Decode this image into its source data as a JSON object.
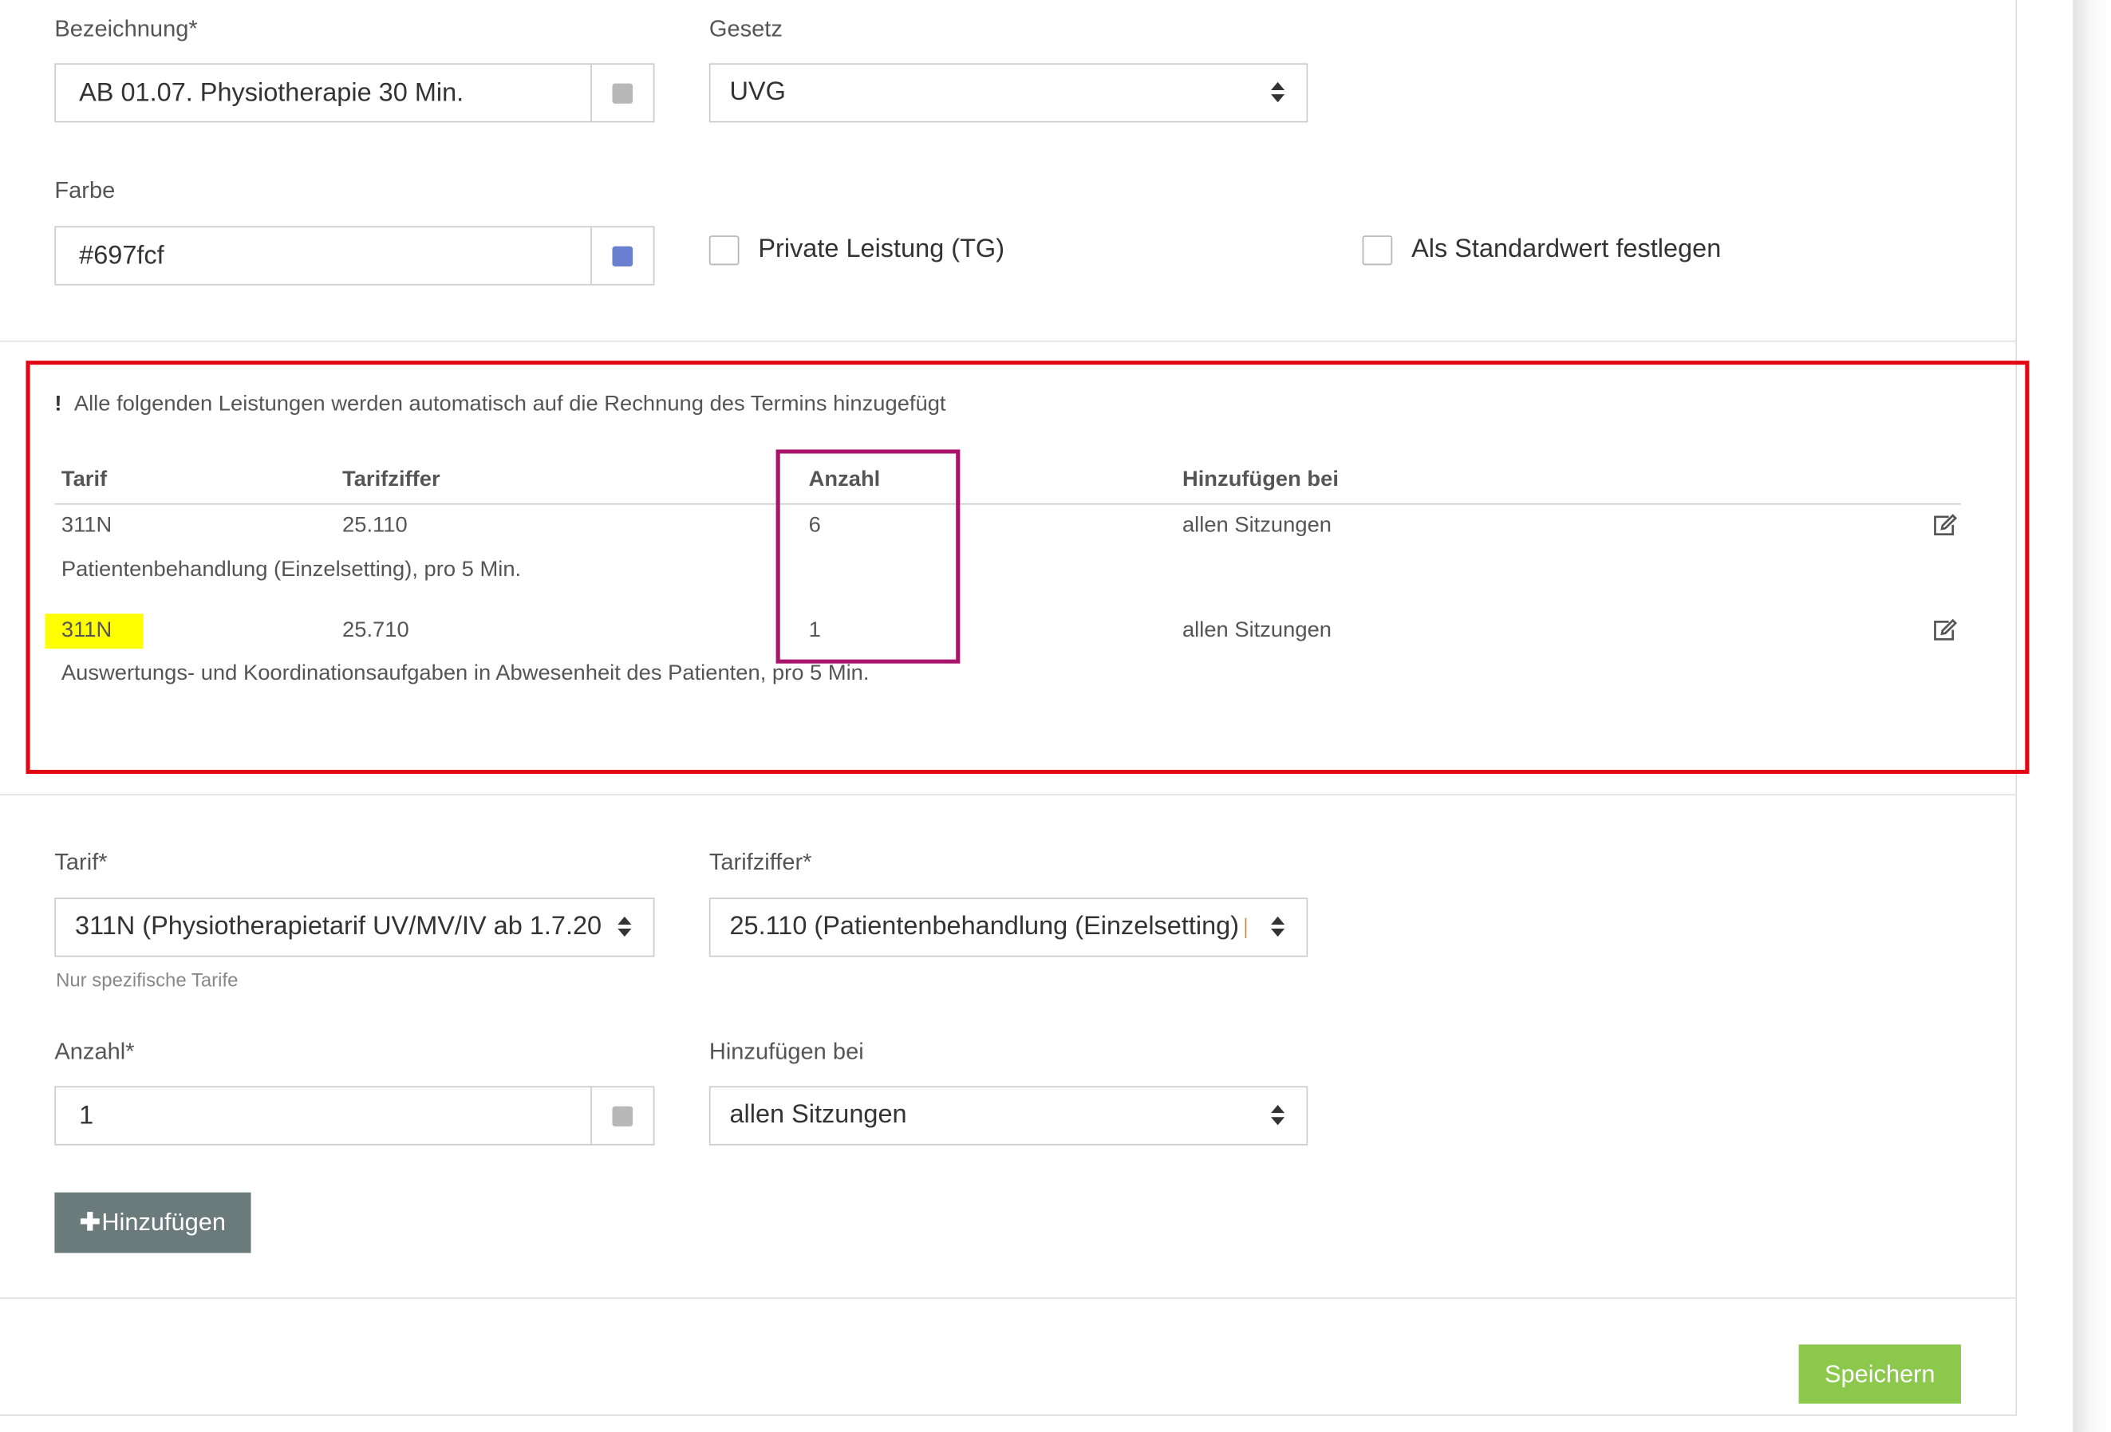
{
  "form": {
    "bezeichnung": {
      "label": "Bezeichnung*",
      "value": "AB 01.07. Physiotherapie 30 Min.",
      "addon_color": "#b8b8b8"
    },
    "gesetz": {
      "label": "Gesetz",
      "value": "UVG"
    },
    "farbe": {
      "label": "Farbe",
      "value": "#697fcf",
      "addon_color": "#697fcf"
    },
    "private_leistung": {
      "label": "Private Leistung (TG)",
      "checked": false
    },
    "standardwert": {
      "label": "Als Standardwert festlegen",
      "checked": false
    }
  },
  "services": {
    "notice_icon": "!",
    "notice": "Alle folgenden Leistungen werden automatisch auf die Rechnung des Termins hinzugefügt",
    "columns": {
      "tarif": "Tarif",
      "tarifziffer": "Tarifziffer",
      "anzahl": "Anzahl",
      "hinzufuegen": "Hinzufügen bei"
    },
    "rows": [
      {
        "tarif": "311N",
        "tarifziffer": "25.110",
        "anzahl": "6",
        "hinzufuegen": "allen Sitzungen",
        "description": "Patientenbehandlung (Einzelsetting), pro 5 Min."
      },
      {
        "tarif": "311N",
        "tarifziffer": "25.710",
        "anzahl": "1",
        "hinzufuegen": "allen Sitzungen",
        "description": "Auswertungs- und Koordinationsaufgaben in Abwesenheit des Patienten, pro 5 Min."
      }
    ],
    "annotation_colors": {
      "frame": "#e30613",
      "anzahl_frame": "#a8146c",
      "highlight": "#ffff00"
    }
  },
  "add_form": {
    "tarif": {
      "label": "Tarif*",
      "value": "311N (Physiotherapietarif UV/MV/IV ab 1.7.20",
      "help": "Nur spezifische Tarife"
    },
    "tarifziffer": {
      "label": "Tarifziffer*",
      "value": "25.110 (Patientenbehandlung (Einzelsetting), "
    },
    "anzahl": {
      "label": "Anzahl*",
      "value": "1",
      "addon_color": "#b8b8b8"
    },
    "hinzufuegen": {
      "label": "Hinzufügen bei",
      "value": "allen Sitzungen"
    },
    "add_button": {
      "icon": "✚",
      "label": "Hinzufügen"
    }
  },
  "footer": {
    "save_label": "Speichern",
    "save_color": "#8cc84b"
  }
}
